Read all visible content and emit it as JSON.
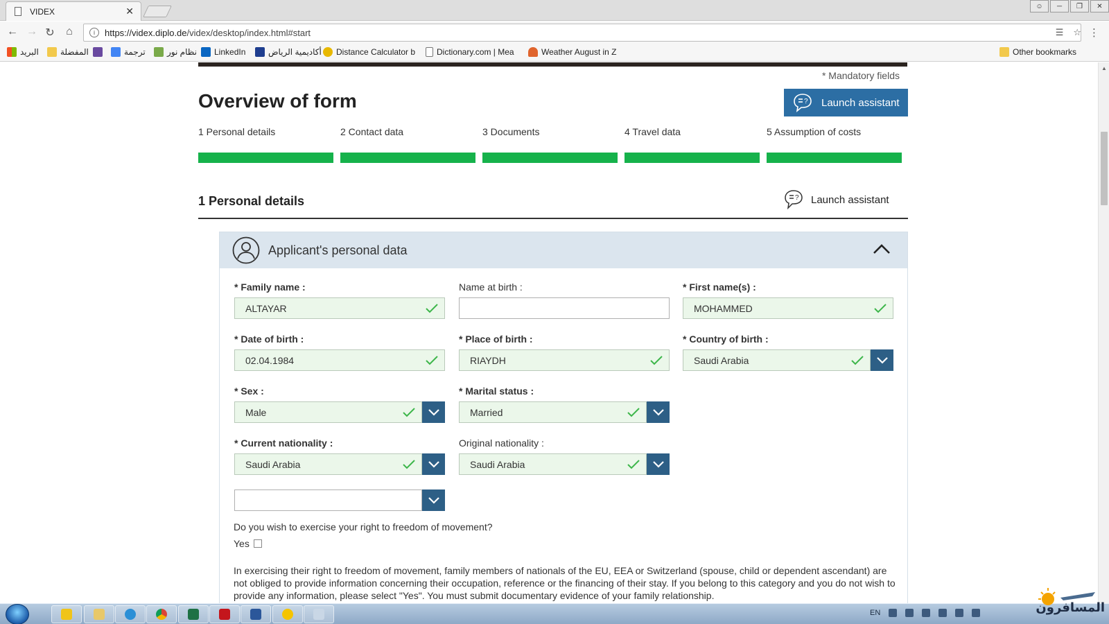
{
  "browser": {
    "tab_title": "VIDEX",
    "tab_close": "✕",
    "url_host": "https://videx.diplo.de",
    "url_path": "/videx/desktop/index.html#start",
    "window_controls": [
      "user",
      "minimize",
      "restore",
      "close"
    ],
    "bookmarks": [
      {
        "label": "البريد",
        "icon": "windows-apps-icon",
        "color": "#e7502f"
      },
      {
        "label": "المفضلة",
        "icon": "folder-icon",
        "color": "#f2c94c"
      },
      {
        "label": "",
        "icon": "app-icon",
        "color": "#6a4aa0"
      },
      {
        "label": "ترجمة",
        "icon": "translate-icon",
        "color": "#4285f4"
      },
      {
        "label": "نظام نور",
        "icon": "noor-icon",
        "color": "#7aaa4a"
      },
      {
        "label": "LinkedIn",
        "icon": "linkedin-icon",
        "color": "#0a66c2"
      },
      {
        "label": "أكاديمية الرياض",
        "icon": "academy-icon",
        "color": "#1f3e8f"
      },
      {
        "label": "Distance Calculator b",
        "icon": "distance-icon",
        "color": "#e8b800"
      },
      {
        "label": "Dictionary.com | Mea",
        "icon": "page-icon",
        "color": "#ffffff"
      },
      {
        "label": "Weather August in Z",
        "icon": "weather-icon",
        "color": "#e0642d"
      }
    ],
    "other_bookmarks": "Other bookmarks"
  },
  "page": {
    "mandatory_note": "* Mandatory fields",
    "title": "Overview of form",
    "launch_assistant": "Launch assistant",
    "steps": [
      {
        "label": "1 Personal details",
        "progress": 1.0
      },
      {
        "label": "2 Contact data",
        "progress": 1.0
      },
      {
        "label": "3 Documents",
        "progress": 1.0
      },
      {
        "label": "4 Travel data",
        "progress": 1.0
      },
      {
        "label": "5 Assumption of costs",
        "progress": 1.0
      }
    ],
    "section_title": "1 Personal details",
    "section_assistant": "Launch assistant",
    "panel_title": "Applicant's personal data",
    "fields": {
      "family_name": {
        "req": "* ",
        "label": "Family name :",
        "value": "ALTAYAR"
      },
      "name_at_birth": {
        "req": "",
        "label": "Name at birth :",
        "value": ""
      },
      "first_names": {
        "req": "* ",
        "label": "First name(s) :",
        "value": "MOHAMMED"
      },
      "date_of_birth": {
        "req": "* ",
        "label": "Date of birth :",
        "value": "02.04.1984"
      },
      "place_of_birth": {
        "req": "* ",
        "label": "Place of birth :",
        "value": "RIAYDH"
      },
      "country_of_birth": {
        "req": "* ",
        "label": "Country of birth :",
        "value": "Saudi Arabia"
      },
      "sex": {
        "req": "* ",
        "label": "Sex :",
        "value": "Male"
      },
      "marital_status": {
        "req": "* ",
        "label": "Marital status :",
        "value": "Married"
      },
      "current_nationality": {
        "req": "* ",
        "label": "Current nationality :",
        "value": "Saudi Arabia"
      },
      "original_nationality": {
        "req": "",
        "label": "Original nationality :",
        "value": "Saudi Arabia"
      },
      "extra_select": {
        "value": ""
      }
    },
    "freedom_question": "Do you wish to exercise your right to freedom of movement?",
    "yes_label": "Yes",
    "freedom_note": "In exercising their right to freedom of movement, family members of nationals of the EU, EEA or Switzerland (spouse, child or dependent ascendant) are not obliged to provide information concerning their occupation, reference or the financing of their stay. If you belong to this category and you do not wish to provide any information, please select \"Yes\". You must submit documentary evidence of your family relationship.",
    "colors": {
      "accent": "#2c6ea4",
      "progress": "#16b24b",
      "valid_bg": "#ebf7ea",
      "select_arrow": "#2d5f86"
    }
  },
  "taskbar": {
    "language": "EN",
    "watermark": "المسافرون"
  }
}
